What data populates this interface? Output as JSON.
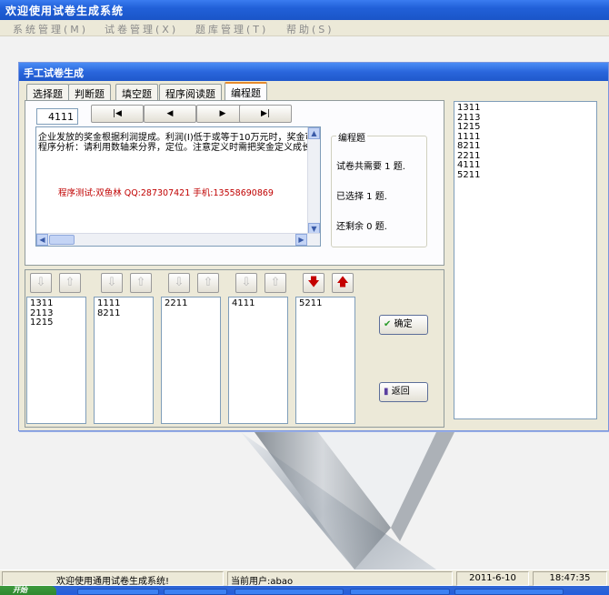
{
  "app": {
    "title": "欢迎使用试卷生成系统",
    "menu": [
      "系统管理(M)",
      "试卷管理(X)",
      "题库管理(T)",
      "帮助(S)"
    ]
  },
  "dialog": {
    "title": "手工试卷生成",
    "tabs": [
      "选择题",
      "判断题",
      "填空题",
      "程序阅读题",
      "编程题"
    ],
    "active_tab": "编程题",
    "question_id": "4111",
    "nav_buttons": [
      "|◀",
      "◀",
      "▶",
      "▶|"
    ],
    "question_lines": [
      "企业发放的奖金根据利润提成。利润(I)低于或等于10万元时，奖金可",
      "程序分析：请利用数轴来分界，定位。注意定义时需把奖金定义成长"
    ],
    "question_note": "程序测试:双鱼林 QQ:287307421 手机:13558690869",
    "info": {
      "legend": "编程题",
      "need": "试卷共需要 1 题.",
      "selected": "已选择 1 题.",
      "remaining": "还剩余 0 题."
    },
    "selected_list": [
      "1311",
      "2113",
      "1215",
      "1111",
      "8211",
      "2211",
      "4111",
      "5211"
    ],
    "columns": [
      [
        "1311",
        "2113",
        "1215"
      ],
      [
        "1111",
        "8211"
      ],
      [
        "2211"
      ],
      [
        "4111"
      ],
      [
        "5211"
      ]
    ],
    "confirm_label": "确定",
    "back_label": "返回"
  },
  "status": {
    "welcome": "欢迎使用通用试卷生成系统!",
    "user": "当前用户:abao",
    "date": "2011-6-10",
    "time": "18:47:35"
  },
  "taskbar": {
    "start_label": "开始"
  },
  "colors": {
    "title_blue": "#2160d8",
    "accent_red": "#c40000",
    "window_bg": "#ece9d8"
  }
}
